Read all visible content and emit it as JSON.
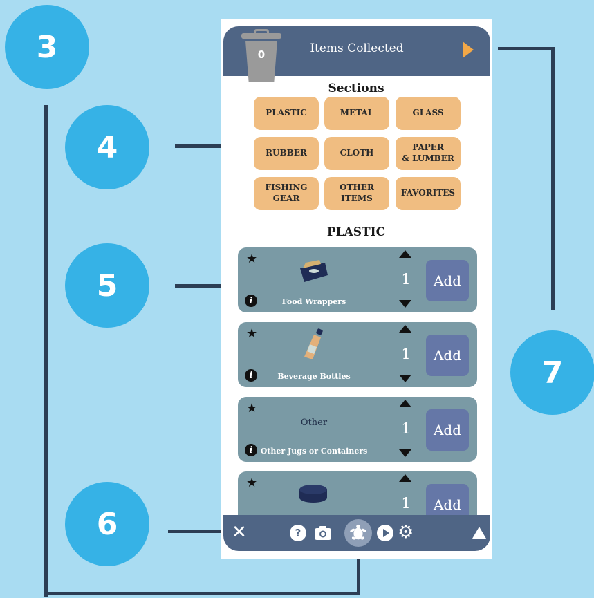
{
  "callouts": [
    "3",
    "4",
    "5",
    "6",
    "7"
  ],
  "header": {
    "items_count": "0",
    "title": "Items Collected"
  },
  "sections": {
    "title": "Sections",
    "buttons": [
      "PLASTIC",
      "METAL",
      "GLASS",
      "RUBBER",
      "CLOTH",
      "PAPER\n& LUMBER",
      "FISHING\nGEAR",
      "OTHER ITEMS",
      "FAVORITES"
    ]
  },
  "category_heading": "PLASTIC",
  "items": [
    {
      "label": "Food Wrappers",
      "quantity": "1",
      "add_label": "Add",
      "icon": "food-wrapper-icon"
    },
    {
      "label": "Beverage Bottles",
      "quantity": "1",
      "add_label": "Add",
      "icon": "bottle-icon"
    },
    {
      "label": "Other Jugs or Containers",
      "other_text": "Other",
      "quantity": "1",
      "add_label": "Add",
      "icon": ""
    },
    {
      "label": "",
      "quantity": "1",
      "add_label": "Add",
      "icon": "bottle-cap-icon"
    }
  ],
  "colors": {
    "background": "#a9dcf2",
    "callout": "#36b2e6",
    "bar": "#4f6585",
    "section_button": "#f0bd81",
    "card": "#7a9aa5",
    "add_button": "#6577a7",
    "accent": "#f3a847"
  }
}
